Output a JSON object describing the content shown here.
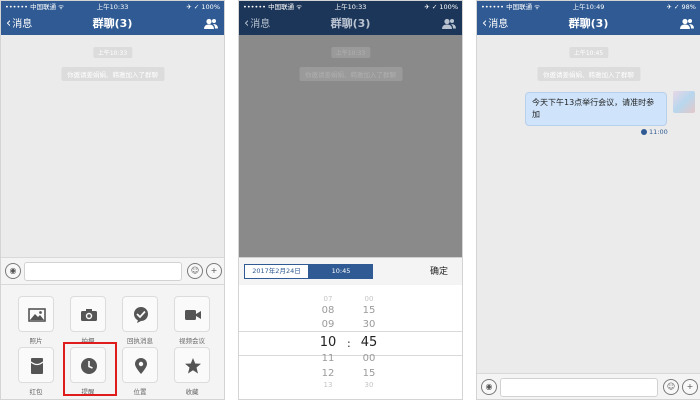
{
  "status": {
    "carrier": "•••••• 中国联通 ᯤ"
  },
  "phones": [
    {
      "status_time": "上午10:33",
      "status_right": "✈ ✓ 100%",
      "back_label": "消息",
      "title": "群聊(3)"
    },
    {
      "status_time": "上午10:33",
      "status_right": "✈ ✓ 100%",
      "back_label": "消息",
      "title": "群聊(3)"
    },
    {
      "status_time": "上午10:49",
      "status_right": "✈ ✓ 98%",
      "back_label": "消息",
      "title": "群聊(3)"
    }
  ],
  "chat": {
    "time_1": "上午10:33",
    "notice": "你邀请姜娟娟、韩雅加入了群聊",
    "time_3": "上午10:45",
    "message": "今天下午13点举行会议，请准时参加",
    "reminder_time": "11:00"
  },
  "panel": {
    "tiles": [
      {
        "label": "照片",
        "icon": "photo-icon"
      },
      {
        "label": "拍摄",
        "icon": "camera-icon"
      },
      {
        "label": "回执消息",
        "icon": "receipt-icon"
      },
      {
        "label": "视频会议",
        "icon": "video-icon"
      },
      {
        "label": "红包",
        "icon": "red-packet-icon"
      },
      {
        "label": "提醒",
        "icon": "clock-icon"
      },
      {
        "label": "位置",
        "icon": "location-icon"
      },
      {
        "label": "收藏",
        "icon": "star-icon"
      }
    ]
  },
  "picker": {
    "date_label": "2017年2月24日",
    "time_label": "10:45",
    "confirm_label": "确定",
    "hours": [
      "07",
      "08",
      "09",
      "10",
      "11",
      "12",
      "13"
    ],
    "minutes": [
      "00",
      "15",
      "30",
      "45",
      "00",
      "15",
      "30"
    ],
    "colon": ":"
  },
  "colors": {
    "nav_blue": "#2f5a93",
    "highlight_red": "#e01b1b",
    "bubble_blue": "#cfe4fb"
  }
}
